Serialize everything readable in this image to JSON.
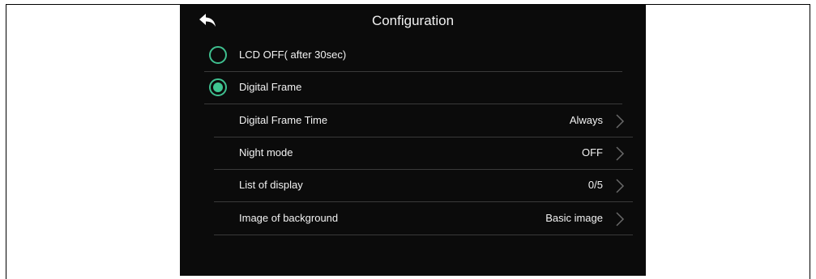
{
  "header": {
    "title": "Configuration",
    "back_icon": "back-arrow-icon"
  },
  "options": [
    {
      "label": "LCD OFF( after 30sec)",
      "selected": false
    },
    {
      "label": "Digital Frame",
      "selected": true
    }
  ],
  "settings": [
    {
      "label": "Digital Frame Time",
      "value": "Always"
    },
    {
      "label": "Night mode",
      "value": "OFF"
    },
    {
      "label": "List of display",
      "value": "0/5"
    },
    {
      "label": "Image of background",
      "value": "Basic image"
    }
  ],
  "colors": {
    "accent": "#3fc591",
    "background": "#0b0b0b",
    "divider": "#3a3a3a"
  }
}
